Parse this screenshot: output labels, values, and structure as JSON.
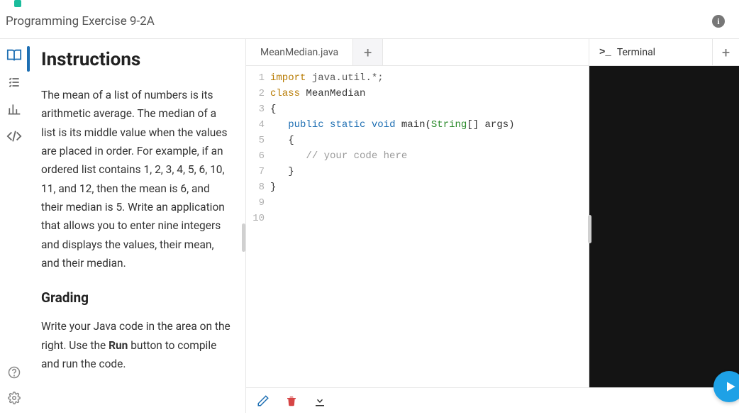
{
  "header": {
    "exercise_title": "Programming Exercise 9-2A"
  },
  "instructions": {
    "heading": "Instructions",
    "body": "The mean of a list of numbers is its arithmetic average. The median of a list is its middle value when the values are placed in order. For example, if an ordered list contains 1, 2, 3, 4, 5, 6, 10, 11, and 12, then the mean is 6, and their median is 5. Write an application that allows you to enter nine integers and displays the values, their mean, and their median.",
    "subheading": "Grading",
    "grading_before": "Write your Java code in the area on the right. Use the ",
    "grading_bold": "Run",
    "grading_after": " button to compile and run the code."
  },
  "editor": {
    "active_tab": "MeanMedian.java",
    "lines": [
      {
        "n": "1",
        "tokens": [
          {
            "t": "import",
            "c": "kw-import"
          },
          {
            "t": " "
          },
          {
            "t": "java.util.*;",
            "c": "kw-pkg"
          }
        ]
      },
      {
        "n": "2",
        "tokens": [
          {
            "t": "class",
            "c": "kw-class"
          },
          {
            "t": " MeanMedian",
            "c": "kw-name"
          }
        ]
      },
      {
        "n": "3",
        "tokens": [
          {
            "t": "{"
          }
        ]
      },
      {
        "n": "4",
        "tokens": [
          {
            "t": "   "
          },
          {
            "t": "public",
            "c": "kw-mod"
          },
          {
            "t": " "
          },
          {
            "t": "static",
            "c": "kw-mod"
          },
          {
            "t": " "
          },
          {
            "t": "void",
            "c": "kw-type"
          },
          {
            "t": " main("
          },
          {
            "t": "String",
            "c": "kw-str"
          },
          {
            "t": "[] args)"
          }
        ]
      },
      {
        "n": "5",
        "tokens": [
          {
            "t": "   {"
          }
        ]
      },
      {
        "n": "6",
        "tokens": [
          {
            "t": "      "
          },
          {
            "t": "// your code here",
            "c": "cmt"
          }
        ]
      },
      {
        "n": "7",
        "tokens": [
          {
            "t": "   }"
          }
        ]
      },
      {
        "n": "8",
        "tokens": [
          {
            "t": "}"
          }
        ]
      },
      {
        "n": "9",
        "tokens": []
      },
      {
        "n": "10",
        "tokens": []
      }
    ]
  },
  "terminal": {
    "tab_label": "Terminal"
  },
  "icons": {
    "book": "book-open-icon",
    "tasks": "checklist-icon",
    "chart": "bar-chart-icon",
    "code": "code-icon",
    "help": "help-icon",
    "settings": "gear-icon",
    "info": "info-icon",
    "pencil": "pencil-icon",
    "trash": "trash-icon",
    "download": "download-icon",
    "play": "play-icon",
    "prompt": "terminal-prompt-icon"
  }
}
